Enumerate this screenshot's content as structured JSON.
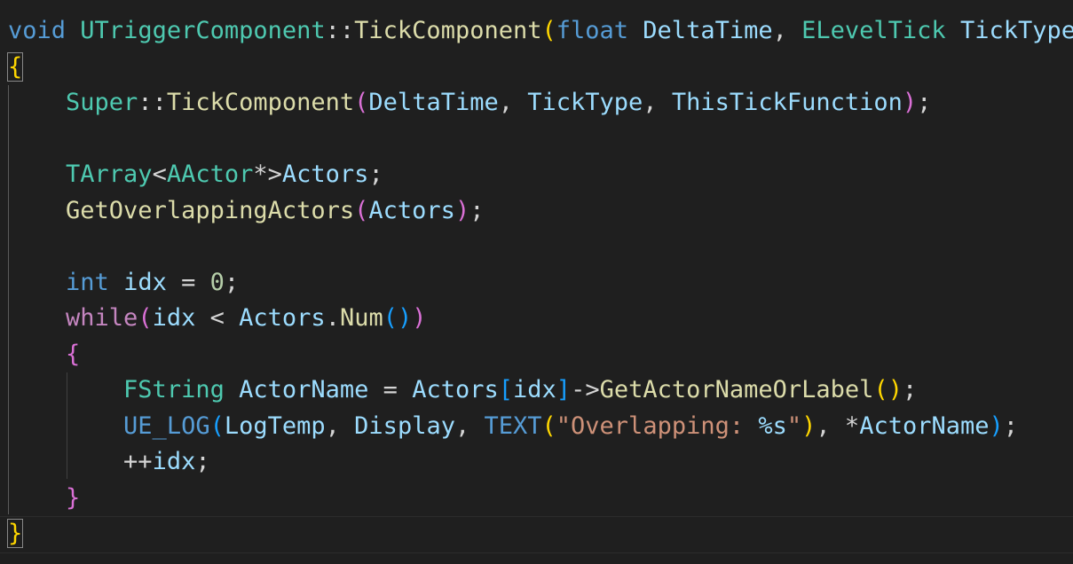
{
  "lines": [
    [
      [
        "kw",
        "void"
      ],
      [
        "p",
        " "
      ],
      [
        "ty",
        "UTriggerComponent"
      ],
      [
        "p",
        "::"
      ],
      [
        "fn",
        "TickComponent"
      ],
      [
        "b1",
        "("
      ],
      [
        "kw",
        "float"
      ],
      [
        "p",
        " "
      ],
      [
        "var",
        "DeltaTime"
      ],
      [
        "p",
        ", "
      ],
      [
        "ty",
        "ELevelTick"
      ],
      [
        "p",
        " "
      ],
      [
        "var",
        "TickType"
      ]
    ],
    [
      [
        "b1",
        "{"
      ]
    ],
    [
      [
        "p",
        "    "
      ],
      [
        "ty",
        "Super"
      ],
      [
        "p",
        "::"
      ],
      [
        "fn",
        "TickComponent"
      ],
      [
        "b2",
        "("
      ],
      [
        "var",
        "DeltaTime"
      ],
      [
        "p",
        ", "
      ],
      [
        "var",
        "TickType"
      ],
      [
        "p",
        ", "
      ],
      [
        "var",
        "ThisTickFunction"
      ],
      [
        "b2",
        ")"
      ],
      [
        "p",
        ";"
      ]
    ],
    [],
    [
      [
        "p",
        "    "
      ],
      [
        "ty",
        "TArray"
      ],
      [
        "p",
        "<"
      ],
      [
        "ty",
        "AActor"
      ],
      [
        "p",
        "*>"
      ],
      [
        "var",
        "Actors"
      ],
      [
        "p",
        ";"
      ]
    ],
    [
      [
        "p",
        "    "
      ],
      [
        "fn",
        "GetOverlappingActors"
      ],
      [
        "b2",
        "("
      ],
      [
        "var",
        "Actors"
      ],
      [
        "b2",
        ")"
      ],
      [
        "p",
        ";"
      ]
    ],
    [],
    [
      [
        "p",
        "    "
      ],
      [
        "kw",
        "int"
      ],
      [
        "p",
        " "
      ],
      [
        "var",
        "idx"
      ],
      [
        "p",
        " = "
      ],
      [
        "num",
        "0"
      ],
      [
        "p",
        ";"
      ]
    ],
    [
      [
        "p",
        "    "
      ],
      [
        "ctl",
        "while"
      ],
      [
        "b2",
        "("
      ],
      [
        "var",
        "idx"
      ],
      [
        "p",
        " < "
      ],
      [
        "var",
        "Actors"
      ],
      [
        "p",
        "."
      ],
      [
        "fn",
        "Num"
      ],
      [
        "b3",
        "()"
      ],
      [
        "b2",
        ")"
      ]
    ],
    [
      [
        "p",
        "    "
      ],
      [
        "b2",
        "{"
      ]
    ],
    [
      [
        "p",
        "        "
      ],
      [
        "ty",
        "FString"
      ],
      [
        "p",
        " "
      ],
      [
        "var",
        "ActorName"
      ],
      [
        "p",
        " = "
      ],
      [
        "var",
        "Actors"
      ],
      [
        "b3",
        "["
      ],
      [
        "var",
        "idx"
      ],
      [
        "b3",
        "]"
      ],
      [
        "p",
        "->"
      ],
      [
        "fn",
        "GetActorNameOrLabel"
      ],
      [
        "b1",
        "()"
      ],
      [
        "p",
        ";"
      ]
    ],
    [
      [
        "p",
        "        "
      ],
      [
        "mac",
        "UE_LOG"
      ],
      [
        "b3",
        "("
      ],
      [
        "var",
        "LogTemp"
      ],
      [
        "p",
        ", "
      ],
      [
        "var",
        "Display"
      ],
      [
        "p",
        ", "
      ],
      [
        "mac",
        "TEXT"
      ],
      [
        "b1",
        "("
      ],
      [
        "str",
        "\"Overlapping: "
      ],
      [
        "fmt",
        "%s"
      ],
      [
        "str",
        "\""
      ],
      [
        "b1",
        ")"
      ],
      [
        "p",
        ", *"
      ],
      [
        "var",
        "ActorName"
      ],
      [
        "b3",
        ")"
      ],
      [
        "p",
        ";"
      ]
    ],
    [
      [
        "p",
        "        ++"
      ],
      [
        "var",
        "idx"
      ],
      [
        "p",
        ";"
      ]
    ],
    [
      [
        "p",
        "    "
      ],
      [
        "b2",
        "}"
      ]
    ],
    [
      [
        "b1",
        "}"
      ]
    ]
  ],
  "theme": {
    "background": "#1f1f1f",
    "keyword": "#569cd6",
    "control": "#c586c0",
    "function": "#dcdcaa",
    "type": "#4ec9b0",
    "variable": "#9cdcfe",
    "string": "#ce9178",
    "number": "#b5cea8",
    "bracket_1": "#ffd700",
    "bracket_2": "#da70d6",
    "bracket_3": "#179fff"
  }
}
